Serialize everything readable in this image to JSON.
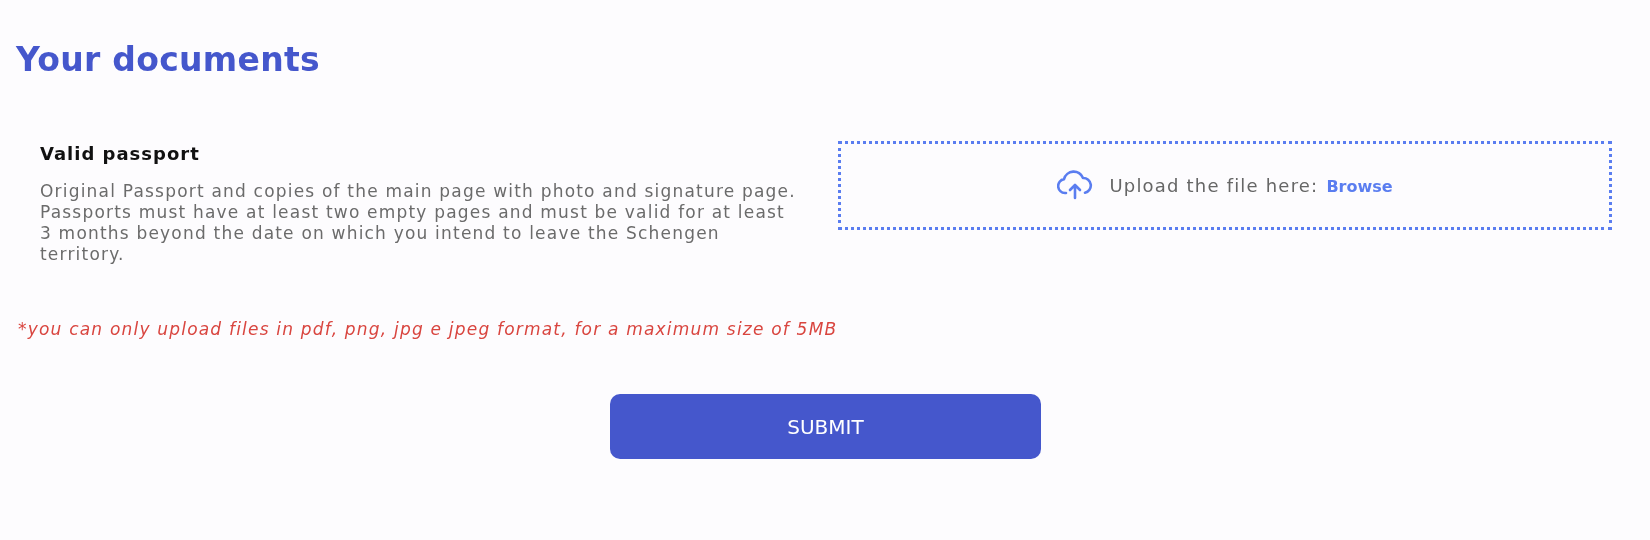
{
  "title": "Your documents",
  "documents": [
    {
      "name": "Valid passport",
      "description": "Original Passport and copies of the main page with photo and signature page. Passports must have at least two empty pages and must be valid for at least 3 months beyond the date on which you intend to leave the Schengen territory.",
      "upload": {
        "prompt": "Upload the file here:",
        "link": "Browse"
      }
    }
  ],
  "note": "*you can only upload files in pdf, png, jpg e jpeg format, for a maximum size of 5MB",
  "submit": "SUBMIT"
}
